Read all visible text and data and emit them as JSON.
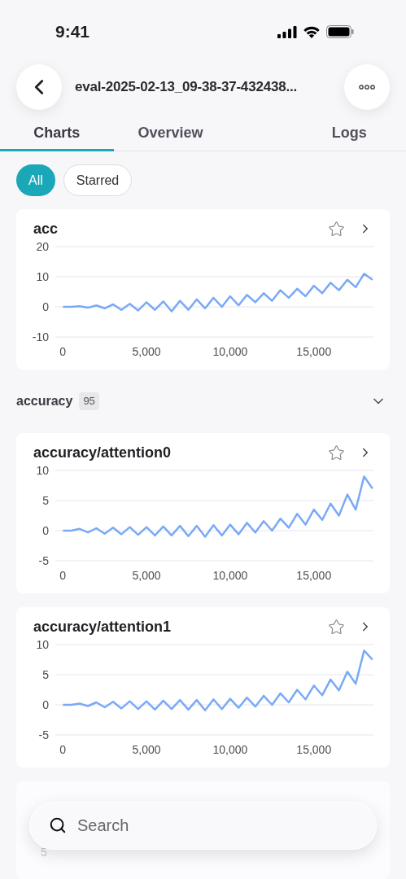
{
  "status_bar": {
    "time": "9:41"
  },
  "header": {
    "title": "eval-2025-02-13_09-38-37-432438..."
  },
  "tabs": [
    {
      "label": "Charts",
      "selected": true
    },
    {
      "label": "Overview",
      "selected": false
    },
    {
      "label": "Logs",
      "selected": false
    }
  ],
  "filters": [
    {
      "label": "All",
      "selected": true
    },
    {
      "label": "Starred",
      "selected": false
    }
  ],
  "cards": [
    {
      "title": "acc",
      "starred": false,
      "chart_data": {
        "type": "line",
        "xlim": [
          -450,
          18560
        ],
        "ylim": [
          -10,
          20
        ],
        "xticks": [
          {
            "value": 0,
            "label": "0"
          },
          {
            "value": 5000,
            "label": "5,000"
          },
          {
            "value": 10000,
            "label": "10,000"
          },
          {
            "value": 15000,
            "label": "15,000"
          }
        ],
        "yticks": [
          {
            "value": 20,
            "label": "20"
          },
          {
            "value": 10,
            "label": "10"
          },
          {
            "value": 0,
            "label": "0"
          },
          {
            "value": -10,
            "label": "-10"
          }
        ],
        "x": [
          0,
          500,
          1000,
          1500,
          2000,
          2500,
          3000,
          3500,
          4000,
          4500,
          5000,
          5500,
          6000,
          6500,
          7000,
          7500,
          8000,
          8500,
          9000,
          9500,
          10000,
          10500,
          11000,
          11500,
          12000,
          12500,
          13000,
          13500,
          14000,
          14500,
          15000,
          15500,
          16000,
          16500,
          17000,
          17500,
          18000,
          18500
        ],
        "series": [
          {
            "color": "#7aaaf5",
            "values": [
              0,
              0,
              0.2,
              -0.3,
              0.5,
              -0.5,
              0.8,
              -1,
              1,
              -1.2,
              1.5,
              -1,
              1.8,
              -1.5,
              2,
              -1,
              2.5,
              -0.5,
              3,
              0,
              3.5,
              0.5,
              4,
              1.5,
              4.5,
              2,
              5.5,
              3,
              6,
              3.5,
              7,
              4.5,
              8,
              5.5,
              9,
              6.5,
              11,
              9
            ]
          }
        ]
      }
    },
    {
      "section": {
        "label": "accuracy",
        "count": "95",
        "expanded": true
      }
    },
    {
      "title": "accuracy/attention0",
      "starred": false,
      "chart_data": {
        "type": "line",
        "xlim": [
          -450,
          18560
        ],
        "ylim": [
          -5,
          10
        ],
        "xticks": [
          {
            "value": 0,
            "label": "0"
          },
          {
            "value": 5000,
            "label": "5,000"
          },
          {
            "value": 10000,
            "label": "10,000"
          },
          {
            "value": 15000,
            "label": "15,000"
          }
        ],
        "yticks": [
          {
            "value": 10,
            "label": "10"
          },
          {
            "value": 5,
            "label": "5"
          },
          {
            "value": 0,
            "label": "0"
          },
          {
            "value": -5,
            "label": "-5"
          }
        ],
        "x": [
          0,
          500,
          1000,
          1500,
          2000,
          2500,
          3000,
          3500,
          4000,
          4500,
          5000,
          5500,
          6000,
          6500,
          7000,
          7500,
          8000,
          8500,
          9000,
          9500,
          10000,
          10500,
          11000,
          11500,
          12000,
          12500,
          13000,
          13500,
          14000,
          14500,
          15000,
          15500,
          16000,
          16500,
          17000,
          17500,
          18000,
          18500
        ],
        "series": [
          {
            "color": "#7aaaf5",
            "values": [
              0,
              0,
              0.3,
              -0.3,
              0.4,
              -0.5,
              0.5,
              -0.6,
              0.6,
              -0.7,
              0.6,
              -0.8,
              0.7,
              -0.8,
              0.8,
              -0.9,
              0.8,
              -1,
              0.9,
              -0.8,
              1,
              -0.6,
              1.3,
              -0.3,
              1.6,
              0,
              2,
              0.5,
              2.8,
              1,
              3.5,
              1.8,
              4.5,
              2.5,
              6,
              3.5,
              9,
              7
            ]
          }
        ]
      }
    },
    {
      "title": "accuracy/attention1",
      "starred": false,
      "chart_data": {
        "type": "line",
        "xlim": [
          -450,
          18560
        ],
        "ylim": [
          -5,
          10
        ],
        "xticks": [
          {
            "value": 0,
            "label": "0"
          },
          {
            "value": 5000,
            "label": "5,000"
          },
          {
            "value": 10000,
            "label": "10,000"
          },
          {
            "value": 15000,
            "label": "15,000"
          }
        ],
        "yticks": [
          {
            "value": 10,
            "label": "10"
          },
          {
            "value": 5,
            "label": "5"
          },
          {
            "value": 0,
            "label": "0"
          },
          {
            "value": -5,
            "label": "-5"
          }
        ],
        "x": [
          0,
          500,
          1000,
          1500,
          2000,
          2500,
          3000,
          3500,
          4000,
          4500,
          5000,
          5500,
          6000,
          6500,
          7000,
          7500,
          8000,
          8500,
          9000,
          9500,
          10000,
          10500,
          11000,
          11500,
          12000,
          12500,
          13000,
          13500,
          14000,
          14500,
          15000,
          15500,
          16000,
          16500,
          17000,
          17500,
          18000,
          18500
        ],
        "series": [
          {
            "color": "#7aaaf5",
            "values": [
              0,
              0,
              0.2,
              -0.2,
              0.4,
              -0.4,
              0.5,
              -0.6,
              0.6,
              -0.7,
              0.6,
              -0.8,
              0.7,
              -0.7,
              0.8,
              -0.8,
              0.8,
              -0.9,
              0.9,
              -0.7,
              1,
              -0.5,
              1.2,
              -0.3,
              1.5,
              0,
              1.9,
              0.4,
              2.5,
              0.9,
              3.2,
              1.6,
              4.2,
              2.4,
              5.5,
              3.5,
              9,
              7.5
            ]
          }
        ]
      }
    },
    {
      "partial": {
        "ytick": "5"
      }
    }
  ],
  "search": {
    "placeholder": "Search"
  }
}
